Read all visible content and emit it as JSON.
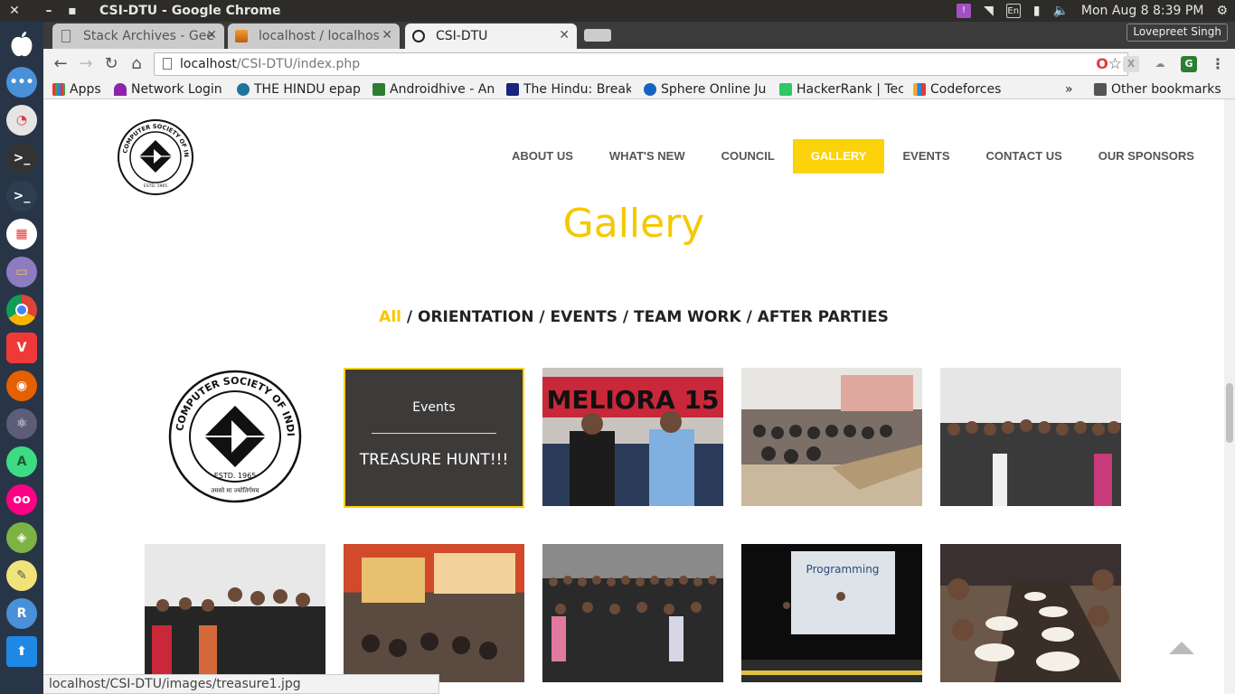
{
  "os": {
    "window_title": "CSI-DTU - Google Chrome",
    "keyboard": "En",
    "clock": "Mon Aug  8  8:39 PM"
  },
  "browser": {
    "tabs": [
      {
        "label": "Stack Archives - Gee",
        "active": false
      },
      {
        "label": "localhost / localhos",
        "active": false
      },
      {
        "label": "CSI-DTU",
        "active": true
      }
    ],
    "profile": "Lovepreet Singh",
    "url_host": "localhost",
    "url_path": "/CSI-DTU/index.php",
    "bookmarks": [
      {
        "label": "Apps",
        "icon": "apps-grid-icon",
        "color": "#d84315"
      },
      {
        "label": "Network Login",
        "icon": "umbrella-icon",
        "color": "#8e24aa"
      },
      {
        "label": "THE HINDU epap",
        "icon": "wordpress-icon",
        "color": "#21759b"
      },
      {
        "label": "Androidhive - An",
        "icon": "android-icon",
        "color": "#2e7d32"
      },
      {
        "label": "The Hindu: Break",
        "icon": "th-icon",
        "color": "#1a237e"
      },
      {
        "label": "Sphere Online Ju",
        "icon": "spoj-icon",
        "color": "#1565c0"
      },
      {
        "label": "HackerRank | Tec",
        "icon": "hackerrank-icon",
        "color": "#2ec866"
      },
      {
        "label": "Codeforces",
        "icon": "codeforces-icon",
        "color": "#f9a825"
      }
    ],
    "bookmarks_overflow": "»",
    "other_bookmarks": "Other bookmarks",
    "status_url": "localhost/CSI-DTU/images/treasure1.jpg"
  },
  "site": {
    "logo": {
      "ring_text": "COMPUTER SOCIETY OF INDIA",
      "estd": "ESTD. 1965",
      "motto": "तमसो मा ज्योतिर्गमय"
    },
    "nav": [
      "ABOUT US",
      "WHAT'S NEW",
      "COUNCIL",
      "GALLERY",
      "EVENTS",
      "CONTACT US",
      "OUR SPONSORS"
    ],
    "nav_active": "GALLERY",
    "gallery_title": "Gallery",
    "filters": {
      "all": "All",
      "rest": " / ORIENTATION / EVENTS / TEAM WORK / AFTER PARTIES"
    },
    "hover_tile": {
      "category": "Events",
      "name": "TREASURE HUNT!!!"
    },
    "tile_texts": {
      "banner": "MELIORA 15",
      "slide": "Programming"
    },
    "accent_color": "#fcd209"
  }
}
